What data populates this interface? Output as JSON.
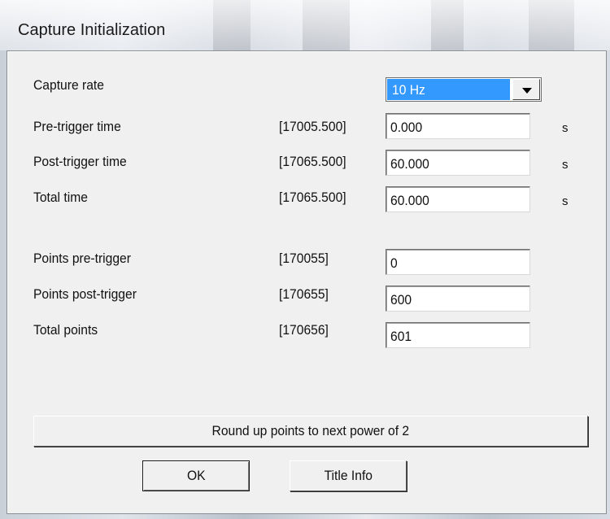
{
  "window": {
    "title": "Capture Initialization"
  },
  "capture_rate": {
    "label": "Capture rate",
    "selected": "10 Hz"
  },
  "time_rows": [
    {
      "label": "Pre-trigger time",
      "bracket": "[17005.500]",
      "value": "0.000",
      "unit": "s"
    },
    {
      "label": "Post-trigger time",
      "bracket": "[17065.500]",
      "value": "60.000",
      "unit": "s"
    },
    {
      "label": "Total time",
      "bracket": "[17065.500]",
      "value": "60.000",
      "unit": "s"
    }
  ],
  "point_rows": [
    {
      "label": "Points pre-trigger",
      "bracket": "[170055]",
      "value": "0"
    },
    {
      "label": "Points post-trigger",
      "bracket": "[170655]",
      "value": "600"
    },
    {
      "label": "Total points",
      "bracket": "[170656]",
      "value": "601"
    }
  ],
  "buttons": {
    "round_up": "Round up points to next power of 2",
    "ok": "OK",
    "title_info": "Title Info"
  }
}
